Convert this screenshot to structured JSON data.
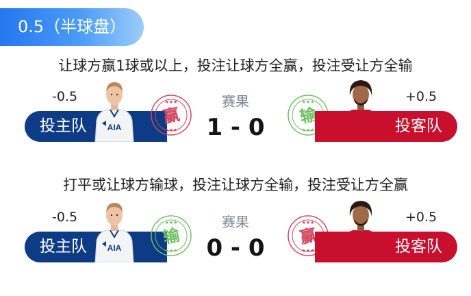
{
  "header": {
    "tag": "0.5（半球盘）"
  },
  "scenarios": [
    {
      "rule": "让球方赢1球或以上，投注让球方全赢，投注受让方全输",
      "home": {
        "handicap": "-0.5",
        "bet_label": "投主队",
        "stamp": "赢"
      },
      "result_label": "赛果",
      "score": "1 - 0",
      "away": {
        "handicap": "+0.5",
        "bet_label": "投客队",
        "stamp": "输"
      }
    },
    {
      "rule": "打平或让球方输球，投注让球方全输，投注受让方全赢",
      "home": {
        "handicap": "-0.5",
        "bet_label": "投主队",
        "stamp": "输"
      },
      "result_label": "赛果",
      "score": "0 - 0",
      "away": {
        "handicap": "+0.5",
        "bet_label": "投客队",
        "stamp": "赢"
      }
    }
  ],
  "colors": {
    "home_team": "#0d3b86",
    "away_team": "#c8102e",
    "win_stamp": "#d2455f",
    "lose_stamp": "#6ec062",
    "tag_gradient_start": "#2577f0",
    "tag_gradient_end": "#9dccfb"
  },
  "icons": {
    "home_player": "player-white-kit-icon",
    "away_player": "player-red-kit-icon",
    "win": "win-stamp-icon",
    "lose": "lose-stamp-icon"
  }
}
